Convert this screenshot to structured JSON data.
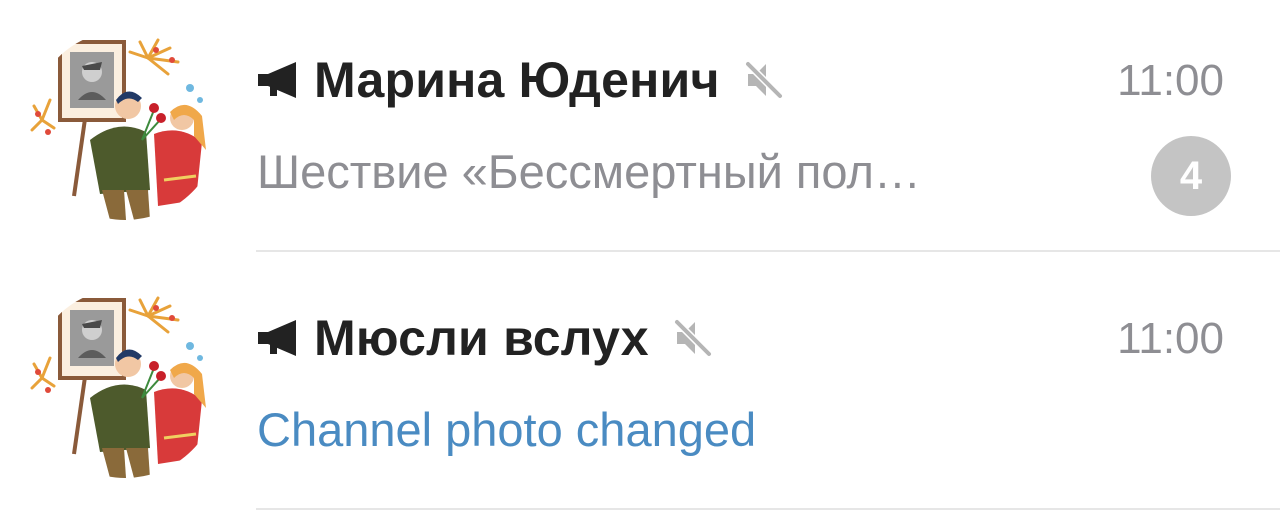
{
  "chats": [
    {
      "name": "Марина Юденич",
      "time": "11:00",
      "preview": "Шествие «Бессмертный пол…",
      "unread_count": "4",
      "type_icon": "megaphone-icon",
      "muted_icon": "muted-speaker-icon"
    },
    {
      "name": "Мюсли вслух",
      "time": "11:00",
      "preview": "Channel photo changed",
      "type_icon": "megaphone-icon",
      "muted_icon": "muted-speaker-icon"
    }
  ],
  "colors": {
    "title": "#222222",
    "time": "#8e8e93",
    "preview": "#8e8e93",
    "service_text": "#4a8bc2",
    "badge_muted": "#c4c4c4",
    "divider": "#e6e6e6"
  }
}
